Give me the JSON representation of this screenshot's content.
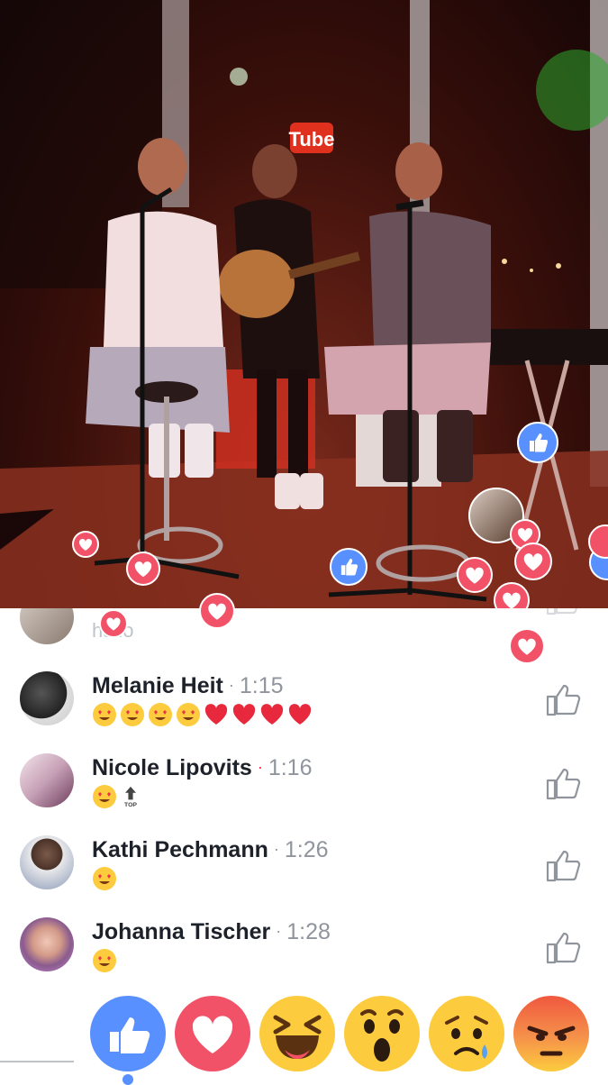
{
  "video": {
    "sign_text": "Tube",
    "floating_reactions": [
      "like",
      "love",
      "love",
      "love",
      "like",
      "love",
      "love",
      "love",
      "love",
      "love",
      "like",
      "love",
      "love"
    ]
  },
  "comments": [
    {
      "name": "",
      "time": "",
      "text": "hallo",
      "partial": true
    },
    {
      "name": "Melanie Heit",
      "time": "1:15",
      "sep": "·",
      "emojis": [
        "heart-eyes",
        "heart-eyes",
        "heart-eyes",
        "heart-eyes",
        "red-heart",
        "red-heart",
        "red-heart",
        "red-heart"
      ]
    },
    {
      "name": "Nicole Lipovits",
      "time": "1:16",
      "sep": "·",
      "emojis": [
        "heart-eyes",
        "top-arrow"
      ],
      "top_label": "TOP"
    },
    {
      "name": "Kathi Pechmann",
      "time": "1:26",
      "sep": "·",
      "emojis": [
        "heart-eyes"
      ]
    },
    {
      "name": "Johanna Tischer",
      "time": "1:28",
      "sep": "·",
      "emojis": [
        "heart-eyes"
      ]
    }
  ],
  "reactions": [
    "like",
    "love",
    "haha",
    "wow",
    "sad",
    "angry"
  ],
  "active_reaction": "like",
  "colors": {
    "like": "#5890ff",
    "love": "#f25268",
    "emoji_yellow": "#fccb3e",
    "angry_top": "#f0583f"
  }
}
